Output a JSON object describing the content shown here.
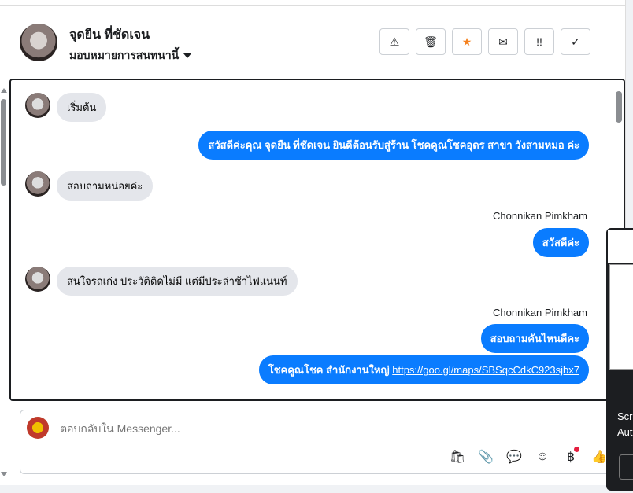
{
  "header": {
    "contact_name": "จุดยืน ที่ชัดเจน",
    "assign_label": "มอบหมายการสนทนานี้",
    "actions": [
      {
        "name": "spam-button",
        "glyph": "⚠"
      },
      {
        "name": "delete-button",
        "glyph": "🗑"
      },
      {
        "name": "star-button",
        "glyph": "★"
      },
      {
        "name": "mark-unread-button",
        "glyph": "✉"
      },
      {
        "name": "follow-up-button",
        "glyph": "!!"
      },
      {
        "name": "mark-done-button",
        "glyph": "✓"
      }
    ]
  },
  "messages": [
    {
      "dir": "in",
      "text": "เริ่มต้น"
    },
    {
      "dir": "out",
      "text": "สวัสดีค่ะคุณ จุดยืน ที่ชัดเจน ยินดีต้อนรับสู่ร้าน โชคคูณโชคอุดร สาขา วังสามหมอ ค่ะ"
    },
    {
      "dir": "in",
      "text": "สอบถามหน่อยค่ะ"
    },
    {
      "dir": "sender",
      "text": "Chonnikan Pimkham"
    },
    {
      "dir": "out",
      "text": "สวัสดีค่ะ"
    },
    {
      "dir": "in",
      "text": "สนใจรถเก่ง  ประวัติติดไม่มี  แต่มีประล่าช้าไฟแนนท์"
    },
    {
      "dir": "sender",
      "text": "Chonnikan Pimkham"
    },
    {
      "dir": "out",
      "text": "สอบถามคันไหนดีคะ"
    },
    {
      "dir": "out",
      "text": "โชคคูณโชค สำนักงานใหญ่",
      "link": "https://goo.gl/maps/SBSqcCdkC923sjbx7"
    }
  ],
  "reply": {
    "placeholder": "ตอบกลับใน Messenger..."
  },
  "tools": [
    {
      "name": "shop-bag-icon",
      "glyph": "🛍"
    },
    {
      "name": "attachment-icon",
      "glyph": "📎"
    },
    {
      "name": "saved-reply-icon",
      "glyph": "💬"
    },
    {
      "name": "emoji-icon",
      "glyph": "☺"
    },
    {
      "name": "payment-icon",
      "glyph": "฿"
    },
    {
      "name": "like-icon",
      "glyph": "👍"
    }
  ],
  "side_panel": {
    "text_line1": "Scr",
    "text_line2": "Aut"
  },
  "colors": {
    "outgoing": "#0a7cff",
    "incoming": "#e4e6eb",
    "star": "#f5821f"
  }
}
